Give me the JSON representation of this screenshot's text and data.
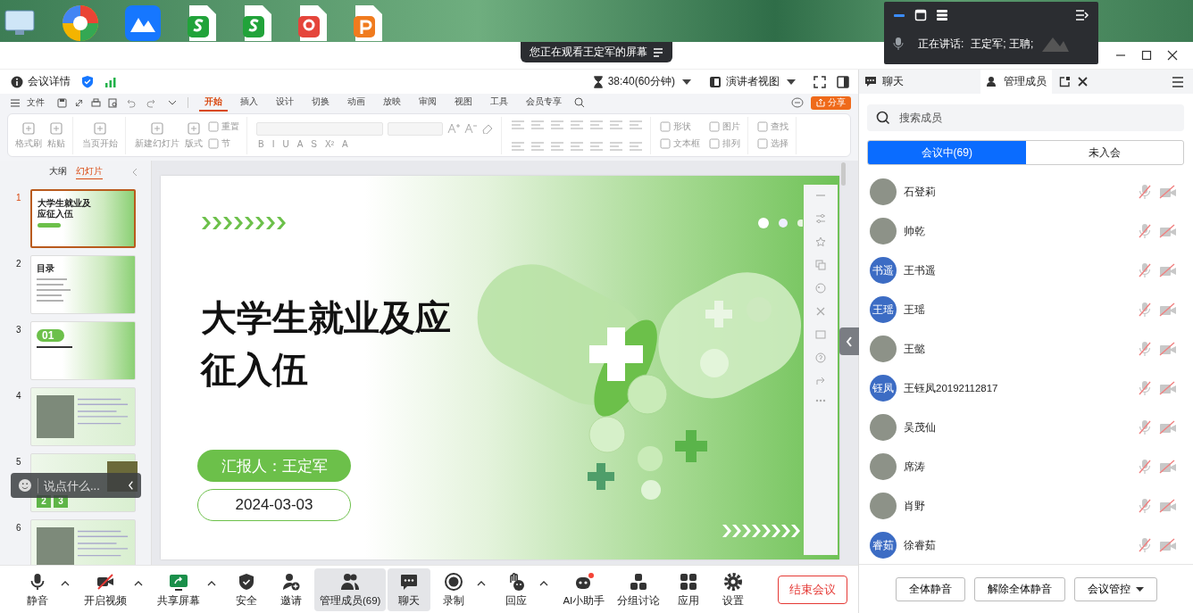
{
  "floating_panel": {
    "speaking_label": "正在讲话:",
    "speakers": "王定军; 王聃;"
  },
  "banner": {
    "text": "您正在观看王定军的屏幕"
  },
  "toolbar": {
    "meeting_info": "会议详情",
    "timer": "38:40(60分钟)",
    "view_mode": "演讲者视图"
  },
  "ribbon": {
    "file_menu": "文件",
    "menu_tabs": [
      {
        "label": "开始",
        "selected": true
      },
      {
        "label": "插入",
        "selected": false
      },
      {
        "label": "设计",
        "selected": false
      },
      {
        "label": "切换",
        "selected": false
      },
      {
        "label": "动画",
        "selected": false
      },
      {
        "label": "放映",
        "selected": false
      },
      {
        "label": "审阅",
        "selected": false
      },
      {
        "label": "视图",
        "selected": false
      },
      {
        "label": "工具",
        "selected": false
      },
      {
        "label": "会员专享",
        "selected": false
      }
    ],
    "share": "分享",
    "tool_groups": [
      {
        "kind": "tools",
        "items": [
          {
            "label": "格式刷",
            "kind": "big"
          },
          {
            "label": "粘贴",
            "kind": "big"
          }
        ]
      },
      {
        "kind": "tools",
        "items": [
          {
            "label": "当页开始",
            "kind": "big"
          }
        ]
      },
      {
        "kind": "tools",
        "items": [
          {
            "label": "新建幻灯片",
            "kind": "big"
          },
          {
            "label": "版式",
            "kind": "big"
          },
          {
            "label": "重置",
            "kind": "small"
          },
          {
            "label": "节",
            "kind": "small"
          }
        ]
      },
      {
        "kind": "font",
        "buttons": [
          "B",
          "I",
          "U",
          "A",
          "S",
          "X²",
          "A"
        ]
      },
      {
        "kind": "paragraph"
      },
      {
        "kind": "tools",
        "items": [
          {
            "label": "形状",
            "kind": "small"
          },
          {
            "label": "文本框",
            "kind": "small"
          },
          {
            "label": "图片",
            "kind": "small"
          },
          {
            "label": "排列",
            "kind": "small"
          }
        ]
      },
      {
        "kind": "tools",
        "items": [
          {
            "label": "查找",
            "kind": "small"
          },
          {
            "label": "选择",
            "kind": "small"
          }
        ]
      }
    ]
  },
  "slide_panel": {
    "tabs": [
      {
        "label": "大纲",
        "selected": false
      },
      {
        "label": "幻灯片",
        "selected": true
      }
    ],
    "thumbnails": [
      {
        "number": "1",
        "selected": true,
        "kind": "title",
        "title": "大学生就业及应征入伍"
      },
      {
        "number": "2",
        "selected": false,
        "kind": "contents",
        "title": "目录"
      },
      {
        "number": "3",
        "selected": false,
        "kind": "section",
        "title": "01"
      },
      {
        "number": "4",
        "selected": false,
        "kind": "photo"
      },
      {
        "number": "5",
        "selected": false,
        "kind": "steps",
        "steps": [
          "2",
          "3"
        ]
      },
      {
        "number": "6",
        "selected": false,
        "kind": "photo"
      }
    ]
  },
  "slide": {
    "title_lines": [
      "大学生就业及应",
      "征入伍"
    ],
    "reporter": "汇报人：王定军",
    "date": "2024-03-03"
  },
  "chat_input": {
    "placeholder": "说点什么..."
  },
  "right_panel": {
    "tabs": [
      {
        "label": "聊天",
        "selected": false
      },
      {
        "label": "管理成员",
        "selected": true
      }
    ],
    "search": {
      "placeholder": "搜索成员"
    },
    "segments": [
      {
        "label": "会议中(69)",
        "selected": true
      },
      {
        "label": "未入会",
        "selected": false
      }
    ],
    "members": [
      {
        "name": "石登莉",
        "kind": "photo",
        "muted": true,
        "camera_off": true
      },
      {
        "name": "帅乾",
        "kind": "photo",
        "muted": true,
        "camera_off": true
      },
      {
        "name": "王书遥",
        "kind": "initials",
        "initials": "书遥",
        "muted": true,
        "camera_off": true
      },
      {
        "name": "王瑶",
        "kind": "initials",
        "initials": "王瑶",
        "muted": true,
        "camera_off": true
      },
      {
        "name": "王懿",
        "kind": "photo",
        "muted": true,
        "camera_off": true
      },
      {
        "name": "王钰凤20192112817",
        "kind": "initials",
        "initials": "钰凤",
        "muted": true,
        "camera_off": true
      },
      {
        "name": "吴茂仙",
        "kind": "photo",
        "muted": true,
        "camera_off": true
      },
      {
        "name": "席涛",
        "kind": "photo",
        "muted": true,
        "camera_off": true
      },
      {
        "name": "肖野",
        "kind": "photo",
        "muted": true,
        "camera_off": true
      },
      {
        "name": "徐睿茹",
        "kind": "initials",
        "initials": "睿茹",
        "muted": true,
        "camera_off": true
      }
    ],
    "actions": [
      {
        "label": "全体静音",
        "kind": "button"
      },
      {
        "label": "解除全体静音",
        "kind": "button"
      },
      {
        "label": "会议管控",
        "kind": "dropdown"
      }
    ]
  },
  "bottom_bar": {
    "items": [
      {
        "label": "静音",
        "kind": "mic",
        "has_menu": true,
        "active": false
      },
      {
        "label": "开启视频",
        "kind": "camera",
        "has_menu": true,
        "active": false
      },
      {
        "label": "共享屏幕",
        "kind": "share",
        "has_menu": true,
        "active": false
      },
      {
        "label": "安全",
        "kind": "shield",
        "has_menu": false,
        "active": false
      },
      {
        "label": "邀请",
        "kind": "invite",
        "has_menu": false,
        "active": false
      },
      {
        "label": "管理成员(69)",
        "kind": "members",
        "has_menu": false,
        "active": true
      },
      {
        "label": "聊天",
        "kind": "chat",
        "has_menu": false,
        "active": true
      },
      {
        "label": "录制",
        "kind": "record",
        "has_menu": true,
        "active": false
      },
      {
        "label": "回应",
        "kind": "hand",
        "has_menu": true,
        "active": false
      },
      {
        "label": "AI小助手",
        "kind": "robot",
        "has_menu": false,
        "active": false
      },
      {
        "label": "分组讨论",
        "kind": "groups",
        "has_menu": false,
        "active": false
      },
      {
        "label": "应用",
        "kind": "apps",
        "has_menu": false,
        "active": false
      },
      {
        "label": "设置",
        "kind": "gear",
        "has_menu": false,
        "active": false
      }
    ],
    "end_button": "结束会议"
  }
}
